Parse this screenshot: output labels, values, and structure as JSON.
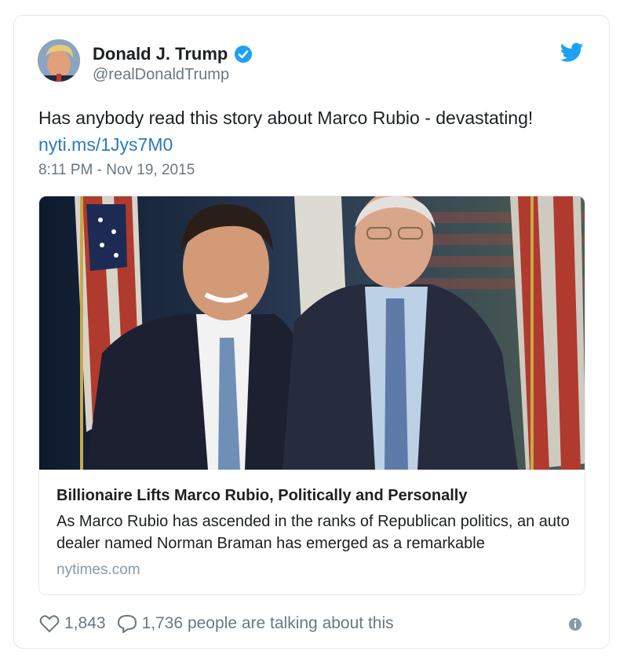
{
  "author": {
    "display_name": "Donald J. Trump",
    "handle": "@realDonaldTrump",
    "verified": true
  },
  "tweet": {
    "text": "Has anybody read this story about Marco Rubio - devastating!",
    "link": "nyti.ms/1Jys7M0",
    "timestamp": "8:11 PM - Nov 19, 2015"
  },
  "card": {
    "title": "Billionaire Lifts Marco Rubio, Politically and Personally",
    "description": "As Marco Rubio has ascended in the ranks of Republican politics, an auto dealer named Norman Braman has emerged as a remarkable",
    "domain": "nytimes.com"
  },
  "footer": {
    "likes": "1,843",
    "conversation": "1,736 people are talking about this"
  },
  "colors": {
    "twitter_blue": "#1da1f2",
    "link": "#2b7bb9",
    "muted": "#697882"
  },
  "icons": [
    "verified-badge-icon",
    "twitter-bird-icon",
    "heart-icon",
    "speech-bubble-icon",
    "info-icon"
  ]
}
